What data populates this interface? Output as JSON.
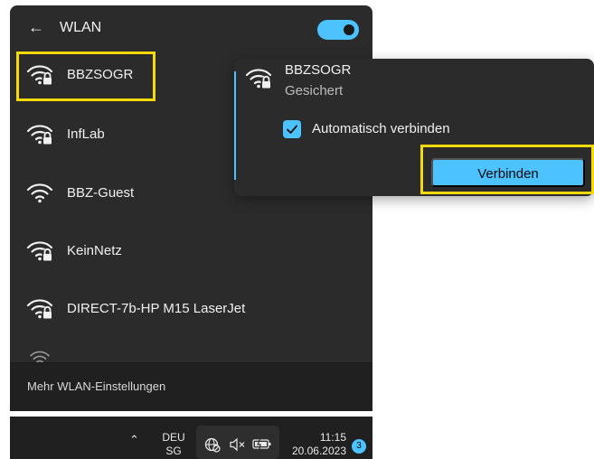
{
  "header": {
    "back_icon": "back-arrow-icon",
    "title": "WLAN",
    "wifi_toggle_on": true
  },
  "networks": [
    {
      "name": "BBZSOGR",
      "secured": true
    },
    {
      "name": "InfLab",
      "secured": true
    },
    {
      "name": "BBZ-Guest",
      "secured": false
    },
    {
      "name": "KeinNetz",
      "secured": true
    },
    {
      "name": "DIRECT-7b-HP M15 LaserJet",
      "secured": true
    }
  ],
  "footer": {
    "more_settings": "Mehr WLAN-Einstellungen"
  },
  "popup": {
    "ssid": "BBZSOGR",
    "status": "Gesichert",
    "auto_connect_label": "Automatisch verbinden",
    "auto_connect_checked": true,
    "connect_label": "Verbinden"
  },
  "taskbar": {
    "lang_line1": "DEU",
    "lang_line2": "SG",
    "time": "11:15",
    "date": "20.06.2023",
    "notifications": "3"
  },
  "colors": {
    "accent": "#4cc2ff",
    "highlight": "#f5d90a",
    "panel": "#2b2b2b"
  }
}
